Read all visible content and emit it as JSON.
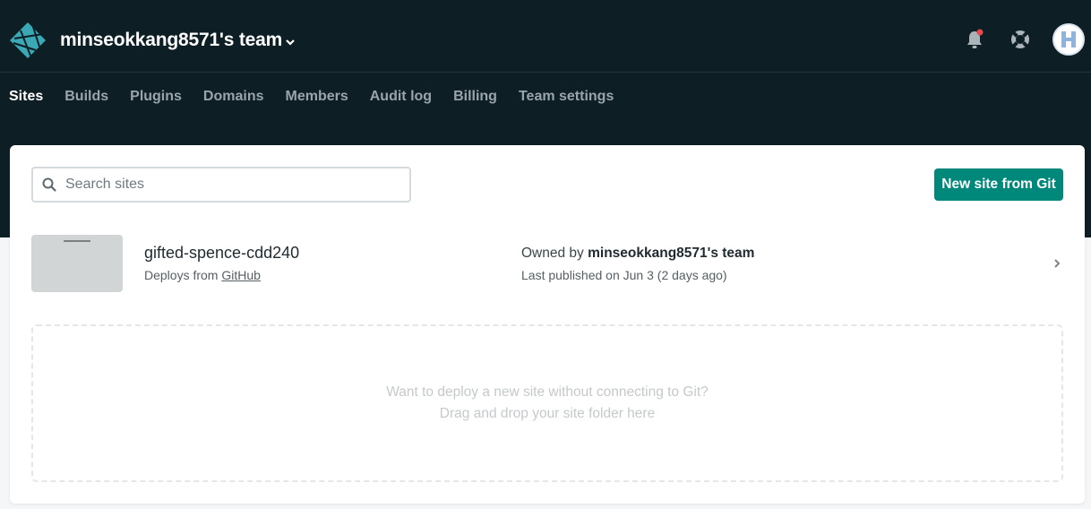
{
  "header": {
    "team_name": "minseokkang8571's team",
    "logo_icon": "netlify-logo-icon",
    "notification_icon": "bell-icon",
    "notification_dot_color": "#e5484d",
    "help_icon": "lifebuoy-icon",
    "avatar_letter": "H"
  },
  "nav": {
    "items": [
      "Sites",
      "Builds",
      "Plugins",
      "Domains",
      "Members",
      "Audit log",
      "Billing",
      "Team settings"
    ],
    "active": "Sites"
  },
  "search": {
    "placeholder": "Search sites",
    "icon": "search-icon"
  },
  "actions": {
    "new_site_label": "New site from Git",
    "accent_color": "#00897b"
  },
  "sites": [
    {
      "name": "gifted-spence-cdd240",
      "deploys_prefix": "Deploys from ",
      "deploys_source": "GitHub",
      "owner_prefix": "Owned by ",
      "owner": "minseokkang8571's team",
      "last_published": "Last published on Jun 3 (2 days ago)"
    }
  ],
  "dropzone": {
    "line1": "Want to deploy a new site without connecting to Git?",
    "line2": "Drag and drop your site folder here"
  },
  "colors": {
    "header_bg": "#0e1e25",
    "nav_inactive": "#9aa5ab"
  }
}
